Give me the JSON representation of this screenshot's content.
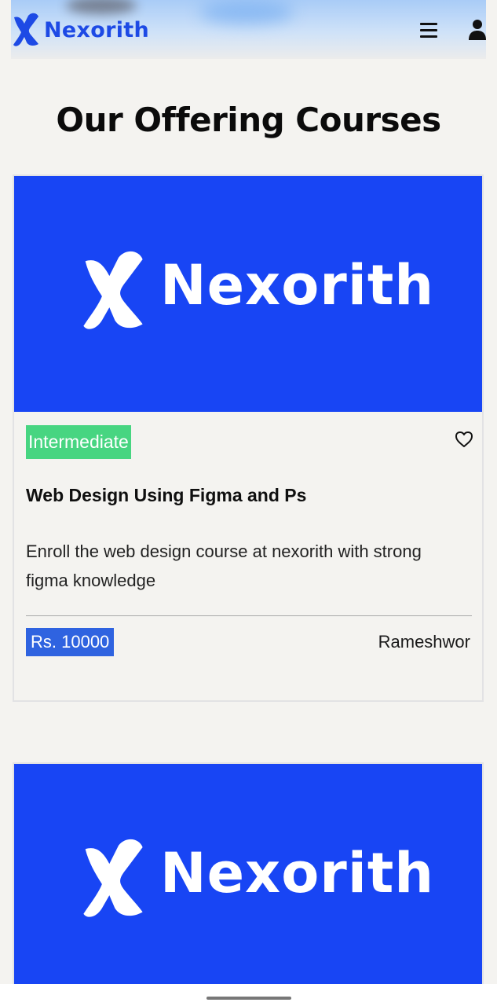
{
  "header": {
    "brand_name": "Nexorith",
    "menu_icon": "hamburger-menu-icon",
    "user_icon": "user-icon"
  },
  "page": {
    "title": "Our Offering Courses"
  },
  "courses": [
    {
      "image_text": "Nexorith",
      "level": "Intermediate",
      "title": "Web Design Using Figma and Ps",
      "description": "Enroll the web design course at nexorith with strong figma knowledge",
      "price": "Rs. 10000",
      "instructor": "Rameshwor",
      "favorite_icon": "heart-outline-icon"
    },
    {
      "image_text": "Nexorith"
    }
  ],
  "colors": {
    "brand_blue": "#1d4ae5",
    "card_image_blue": "#1845f4",
    "level_badge_green": "#47d581",
    "price_badge_blue": "#2f63e0",
    "background": "#f4f3f0"
  }
}
